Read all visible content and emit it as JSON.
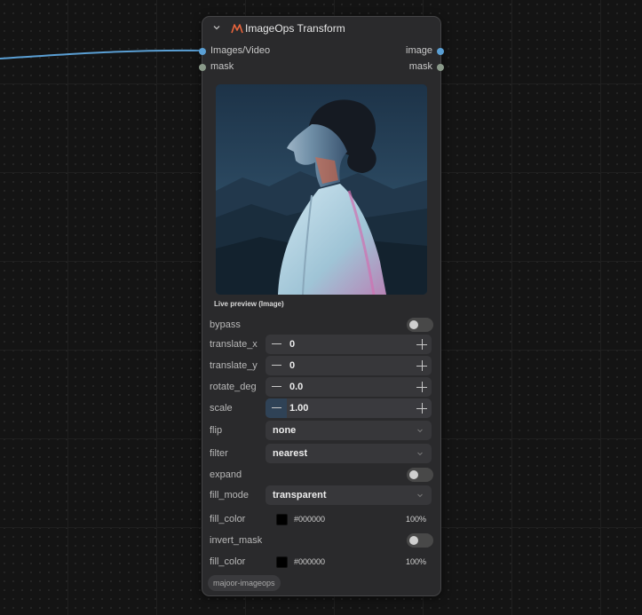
{
  "node": {
    "title": "ImageOps Transform",
    "inputs": [
      {
        "label": "Images/Video",
        "color": "#5a9fd4",
        "connected": true
      },
      {
        "label": "mask",
        "color": "#8a9a8a",
        "connected": false
      }
    ],
    "outputs": [
      {
        "label": "image",
        "color": "#5a9fd4"
      },
      {
        "label": "mask",
        "color": "#8a9a8a"
      }
    ],
    "preview_label": "Live preview (Image)",
    "widgets": {
      "bypass": {
        "label": "bypass",
        "on": false
      },
      "translate_x": {
        "label": "translate_x",
        "value": "0"
      },
      "translate_y": {
        "label": "translate_y",
        "value": "0"
      },
      "rotate_deg": {
        "label": "rotate_deg",
        "value": "0.0"
      },
      "scale": {
        "label": "scale",
        "value": "1.00"
      },
      "flip": {
        "label": "flip",
        "value": "none"
      },
      "filter": {
        "label": "filter",
        "value": "nearest"
      },
      "expand": {
        "label": "expand",
        "on": false
      },
      "fill_mode": {
        "label": "fill_mode",
        "value": "transparent"
      },
      "fill_color": {
        "label": "fill_color",
        "hex": "#000000",
        "alpha": "100%"
      },
      "invert_mask": {
        "label": "invert_mask",
        "on": false
      },
      "fill_color_2": {
        "label": "fill_color",
        "hex": "#000000",
        "alpha": "100%"
      }
    },
    "badge": "majoor-imageops"
  },
  "colors": {
    "accent": "#5a9fd4",
    "logo": "#e8643c",
    "node_bg": "#2a2a2c"
  },
  "icons": [
    "chevron-down-icon",
    "logo-icon",
    "minus-icon",
    "plus-icon",
    "dropdown-chevron-icon"
  ]
}
